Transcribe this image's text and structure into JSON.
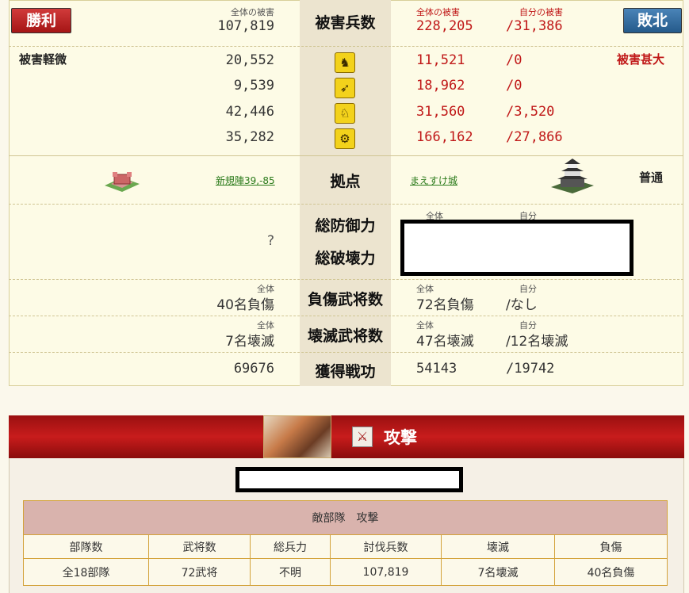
{
  "header": {
    "win_label": "勝利",
    "lose_label": "敗北",
    "total_damage_label": "全体の被害",
    "self_damage_label": "自分の被害",
    "title": "被害兵数",
    "left_total": "107,819",
    "right_total": "228,205",
    "right_self": "/31,386"
  },
  "damage": {
    "left_status": "被害軽微",
    "right_status": "被害甚大",
    "rows": [
      {
        "icon": "spearman-icon",
        "left": "20,552",
        "right_total": "11,521",
        "right_self": "/0"
      },
      {
        "icon": "archer-icon",
        "left": "9,539",
        "right_total": "18,962",
        "right_self": "/0"
      },
      {
        "icon": "cavalry-icon",
        "left": "42,446",
        "right_total": "31,560",
        "right_self": "/3,520"
      },
      {
        "icon": "siege-weapon-icon",
        "left": "35,282",
        "right_total": "166,162",
        "right_self": "/27,866"
      }
    ]
  },
  "base": {
    "label": "拠点",
    "left_link": "新規陣39,-85",
    "right_link": "まえすけ城",
    "right_type": "普通"
  },
  "defense": {
    "unknown": "?",
    "defense_label": "総防御力",
    "destroy_label": "総破壊力",
    "total_label": "全体",
    "self_label": "自分"
  },
  "wounded": {
    "label": "負傷武将数",
    "total_label": "全体",
    "self_label": "自分",
    "left": "40名負傷",
    "right_total": "72名負傷",
    "right_self": "/なし"
  },
  "destroyed": {
    "label": "壊滅武将数",
    "total_label": "全体",
    "self_label": "自分",
    "left": "7名壊滅",
    "right_total": "47名壊滅",
    "right_self": "/12名壊滅"
  },
  "merit": {
    "label": "獲得戦功",
    "left": "69676",
    "right_total": "54143",
    "right_self": "/19742"
  },
  "attack": {
    "title": "攻撃",
    "enemy_table": {
      "caption": "敵部隊　攻撃",
      "headers": [
        "部隊数",
        "武将数",
        "総兵力",
        "討伐兵数",
        "壊滅",
        "負傷"
      ],
      "values": [
        "全18部隊",
        "72武将",
        "不明",
        "107,819",
        "7名壊滅",
        "40名負傷"
      ]
    }
  },
  "colors": {
    "accent_red": "#c01818",
    "win_red": "#b52020",
    "lose_blue": "#336a9a",
    "banner_red": "#b01818"
  }
}
